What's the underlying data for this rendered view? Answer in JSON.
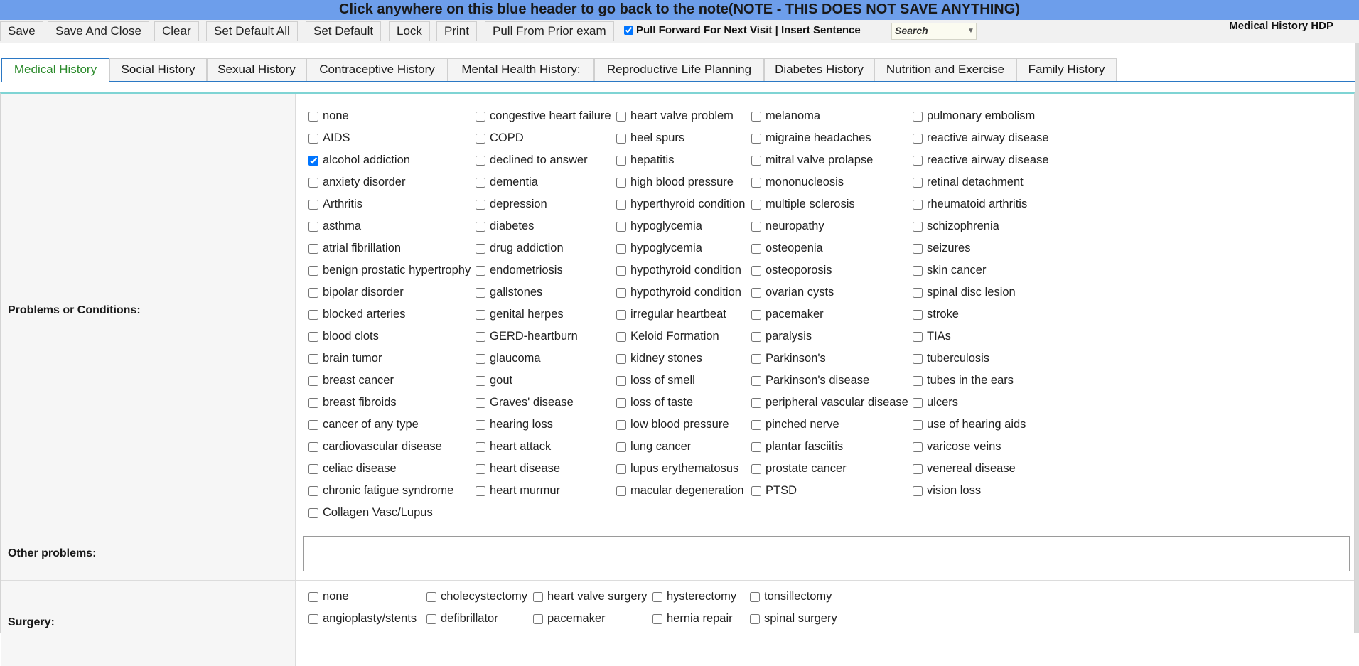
{
  "header": {
    "text": "Click anywhere on this blue header to go back to the note(NOTE - THIS DOES NOT SAVE ANYTHING)"
  },
  "toolbar": {
    "buttons": [
      "Save",
      "Save And Close",
      "Clear",
      "Set Default All",
      "Set Default",
      "Lock",
      "Print",
      "Pull From Prior exam"
    ],
    "pull_forward_checked": true,
    "pull_forward_label": "Pull Forward For Next Visit | Insert Sentence",
    "search_placeholder": "Search",
    "form_name": "Medical History HDP"
  },
  "tabs": [
    "Medical History",
    "Social History",
    "Sexual History",
    "Contraceptive History",
    "Mental Health History:",
    "Reproductive Life Planning",
    "Diabetes History",
    "Nutrition and Exercise",
    "Family History"
  ],
  "active_tab": "Medical History",
  "problems": {
    "label": "Problems or Conditions:",
    "columns": [
      [
        {
          "t": "none"
        },
        {
          "t": "AIDS"
        },
        {
          "t": "alcohol addiction",
          "c": true
        },
        {
          "t": "anxiety disorder"
        },
        {
          "t": "Arthritis"
        },
        {
          "t": "asthma"
        },
        {
          "t": "atrial fibrillation"
        },
        {
          "t": "benign prostatic hypertrophy"
        },
        {
          "t": "bipolar disorder"
        },
        {
          "t": "blocked arteries"
        },
        {
          "t": "blood clots"
        },
        {
          "t": "brain tumor"
        },
        {
          "t": "breast cancer"
        },
        {
          "t": "breast fibroids"
        },
        {
          "t": "cancer of any type"
        },
        {
          "t": "cardiovascular disease"
        },
        {
          "t": "celiac disease"
        },
        {
          "t": "chronic fatigue syndrome"
        },
        {
          "t": "Collagen Vasc/Lupus"
        }
      ],
      [
        {
          "t": "congestive heart failure"
        },
        {
          "t": "COPD"
        },
        {
          "t": "declined to answer"
        },
        {
          "t": "dementia"
        },
        {
          "t": "depression"
        },
        {
          "t": "diabetes"
        },
        {
          "t": "drug addiction"
        },
        {
          "t": "endometriosis"
        },
        {
          "t": "gallstones"
        },
        {
          "t": "genital herpes"
        },
        {
          "t": "GERD-heartburn"
        },
        {
          "t": "glaucoma"
        },
        {
          "t": "gout"
        },
        {
          "t": "Graves' disease"
        },
        {
          "t": "hearing loss"
        },
        {
          "t": "heart attack"
        },
        {
          "t": "heart disease"
        },
        {
          "t": "heart murmur"
        }
      ],
      [
        {
          "t": "heart valve problem"
        },
        {
          "t": "heel spurs"
        },
        {
          "t": "hepatitis"
        },
        {
          "t": "high blood pressure"
        },
        {
          "t": "hyperthyroid condition"
        },
        {
          "t": "hypoglycemia"
        },
        {
          "t": "hypoglycemia"
        },
        {
          "t": "hypothyroid condition"
        },
        {
          "t": "hypothyroid condition"
        },
        {
          "t": "irregular heartbeat"
        },
        {
          "t": "Keloid Formation"
        },
        {
          "t": "kidney stones"
        },
        {
          "t": "loss of smell"
        },
        {
          "t": "loss of taste"
        },
        {
          "t": "low blood pressure"
        },
        {
          "t": "lung cancer"
        },
        {
          "t": "lupus erythematosus"
        },
        {
          "t": "macular degeneration"
        }
      ],
      [
        {
          "t": "melanoma"
        },
        {
          "t": "migraine headaches"
        },
        {
          "t": "mitral valve prolapse"
        },
        {
          "t": "mononucleosis"
        },
        {
          "t": "multiple sclerosis"
        },
        {
          "t": "neuropathy"
        },
        {
          "t": "osteopenia"
        },
        {
          "t": "osteoporosis"
        },
        {
          "t": "ovarian cysts"
        },
        {
          "t": "pacemaker"
        },
        {
          "t": "paralysis"
        },
        {
          "t": "Parkinson's"
        },
        {
          "t": "Parkinson's disease"
        },
        {
          "t": "peripheral vascular disease"
        },
        {
          "t": "pinched nerve"
        },
        {
          "t": "plantar fasciitis"
        },
        {
          "t": "prostate cancer"
        },
        {
          "t": "PTSD"
        }
      ],
      [
        {
          "t": "pulmonary embolism"
        },
        {
          "t": "reactive airway disease"
        },
        {
          "t": "reactive airway disease"
        },
        {
          "t": "retinal detachment"
        },
        {
          "t": "rheumatoid arthritis"
        },
        {
          "t": "schizophrenia"
        },
        {
          "t": "seizures"
        },
        {
          "t": "skin cancer"
        },
        {
          "t": "spinal disc lesion"
        },
        {
          "t": "stroke"
        },
        {
          "t": "TIAs"
        },
        {
          "t": "tuberculosis"
        },
        {
          "t": "tubes in the ears"
        },
        {
          "t": "ulcers"
        },
        {
          "t": "use of hearing aids"
        },
        {
          "t": "varicose veins"
        },
        {
          "t": "venereal disease"
        },
        {
          "t": "vision loss"
        }
      ]
    ]
  },
  "other_problems": {
    "label": "Other problems:",
    "value": ""
  },
  "surgery": {
    "label": "Surgery:",
    "columns": [
      [
        {
          "t": "none"
        },
        {
          "t": "angioplasty/stents"
        }
      ],
      [
        {
          "t": "cholecystectomy"
        },
        {
          "t": "defibrillator"
        }
      ],
      [
        {
          "t": "heart valve surgery"
        },
        {
          "t": "pacemaker"
        }
      ],
      [
        {
          "t": "hysterectomy"
        },
        {
          "t": "hernia repair"
        }
      ],
      [
        {
          "t": "tonsillectomy"
        },
        {
          "t": "spinal surgery"
        }
      ]
    ]
  }
}
